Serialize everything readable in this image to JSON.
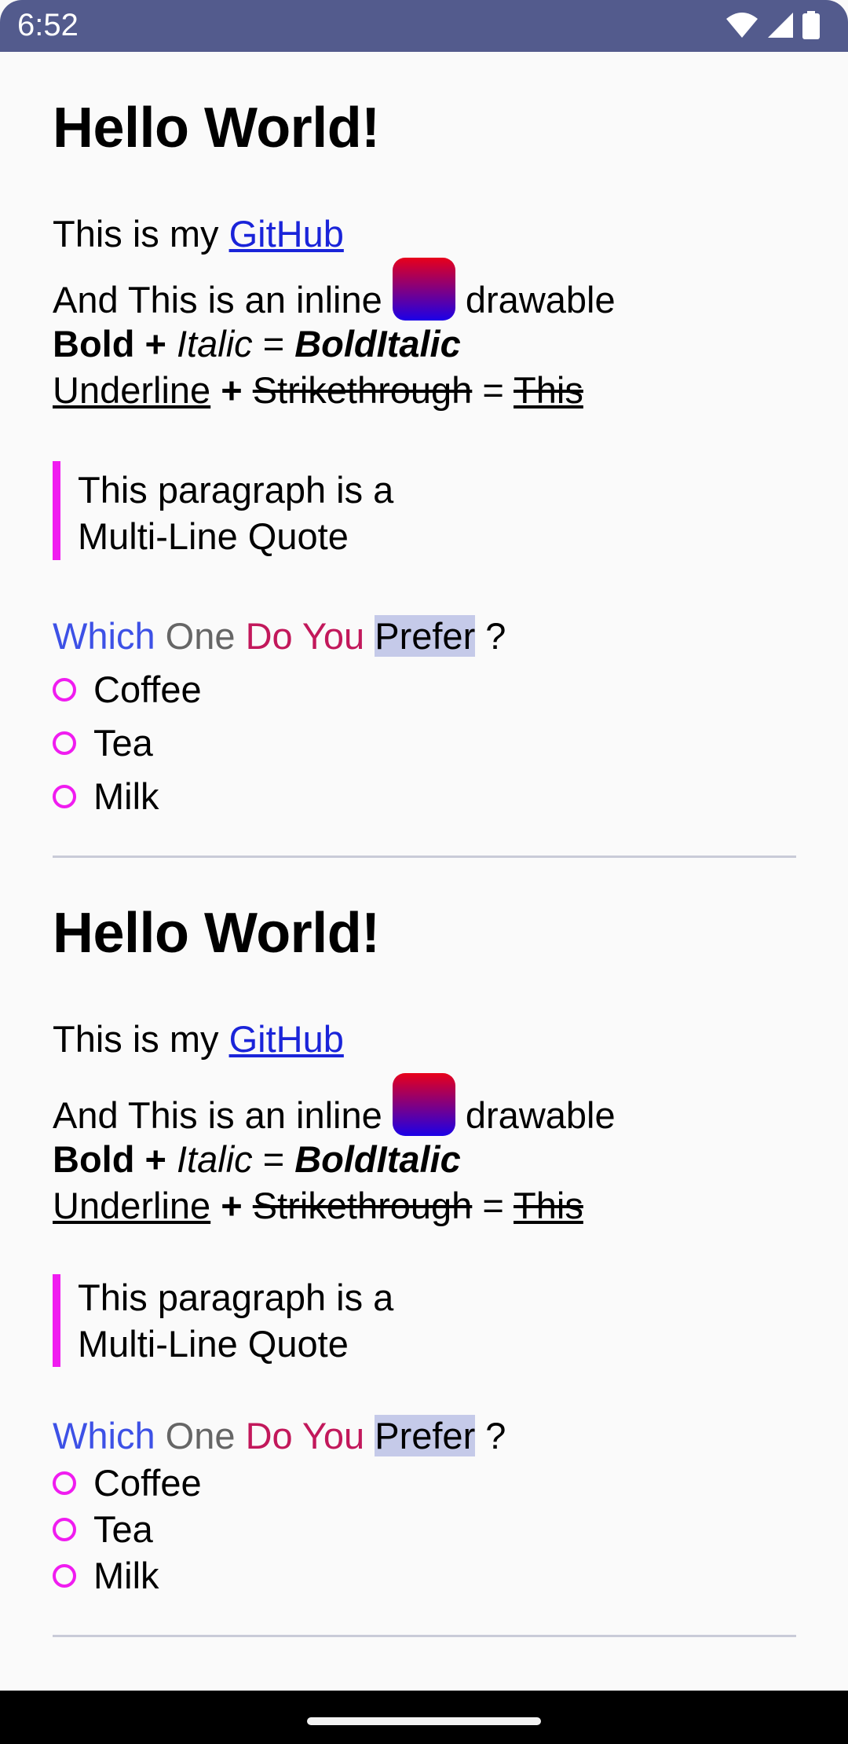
{
  "status_bar": {
    "time": "6:52",
    "icons": [
      "wifi-icon",
      "cellular-signal-icon",
      "battery-icon"
    ],
    "background": "#535b8d"
  },
  "sections": [
    {
      "title": "Hello World!",
      "github_line": {
        "prefix": "This is my ",
        "link": "GitHub"
      },
      "drawable_line": {
        "prefix": "And This is an inline ",
        "suffix": " drawable"
      },
      "style_line": {
        "bold": "Bold",
        "plus": " + ",
        "italic": "Italic",
        "equals": " = ",
        "bold_italic": "BoldItalic"
      },
      "deco_line": {
        "underline": "Underline",
        "plus": " + ",
        "strike": "Strikethrough",
        "equals": " = ",
        "both": "This"
      },
      "quote": {
        "line1": "This paragraph is a",
        "line2": "Multi-Line Quote"
      },
      "question": {
        "which": "Which",
        "one": "One",
        "do_you": "Do You",
        "prefer": "Prefer",
        "mark": " ?"
      },
      "options": [
        "Coffee",
        "Tea",
        "Milk"
      ]
    },
    {
      "title": "Hello World!",
      "github_line": {
        "prefix": "This is my ",
        "link": "GitHub"
      },
      "drawable_line": {
        "prefix": "And This is an inline ",
        "suffix": " drawable"
      },
      "style_line": {
        "bold": "Bold",
        "plus": " + ",
        "italic": "Italic",
        "equals": " = ",
        "bold_italic": "BoldItalic"
      },
      "deco_line": {
        "underline": "Underline",
        "plus": " + ",
        "strike": "Strikethrough",
        "equals": " = ",
        "both": "This"
      },
      "quote": {
        "line1": "This paragraph is a",
        "line2": "Multi-Line Quote"
      },
      "question": {
        "which": "Which",
        "one": "One",
        "do_you": "Do You",
        "prefer": "Prefer",
        "mark": " ?"
      },
      "options": [
        "Coffee",
        "Tea",
        "Milk"
      ]
    }
  ],
  "colors": {
    "link": "#1a24d9",
    "quote_bar": "#f01cf0",
    "radio": "#f01cf0",
    "which": "#3d51e6",
    "do_you": "#c2185b",
    "prefer_highlight": "#c5cae9",
    "drawable_top": "#e8001a",
    "drawable_bottom": "#1b00e8"
  }
}
